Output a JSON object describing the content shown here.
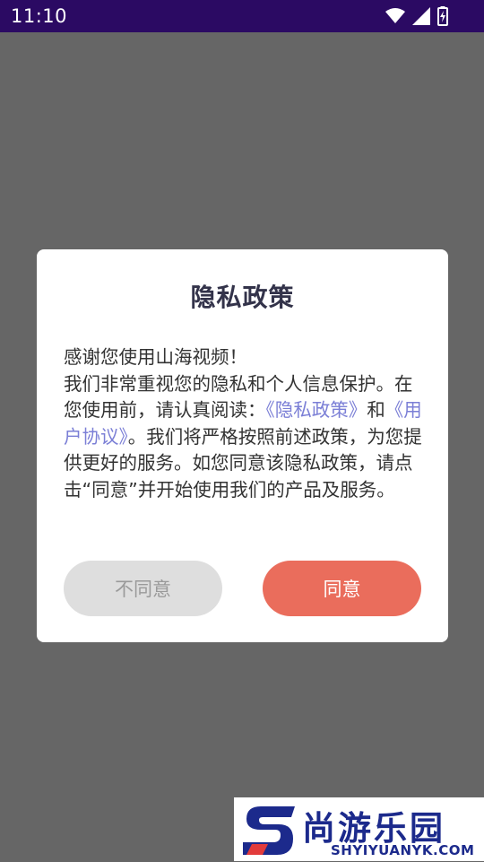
{
  "status_bar": {
    "time": "11:10",
    "icons": [
      "wifi-icon",
      "signal-icon",
      "battery-charging-icon"
    ]
  },
  "dialog": {
    "title": "隐私政策",
    "greeting": "感谢您使用山海视频！",
    "body_1": "我们非常重视您的隐私和个人信息保护。在您使用前，请认真阅读：",
    "link_privacy": "《隐私政策》",
    "conj": "和",
    "link_agreement": "《用户协议》",
    "body_2": "。我们将严格按照前述政策，为您提供更好的服务。如您同意该隐私政策，请点击“同意”并开始使用我们的产品及服务。",
    "disagree_label": "不同意",
    "agree_label": "同意"
  },
  "watermark": {
    "brand": "尚游乐园",
    "domain": "SHYIYUANYK.COM"
  },
  "colors": {
    "status_bar": "#2b0a63",
    "overlay": "#666666",
    "link": "#7b7fd6",
    "agree_button": "#ea6d5c",
    "disagree_button": "#dedede",
    "title": "#33334a",
    "watermark_blue": "#1c2a8c"
  }
}
